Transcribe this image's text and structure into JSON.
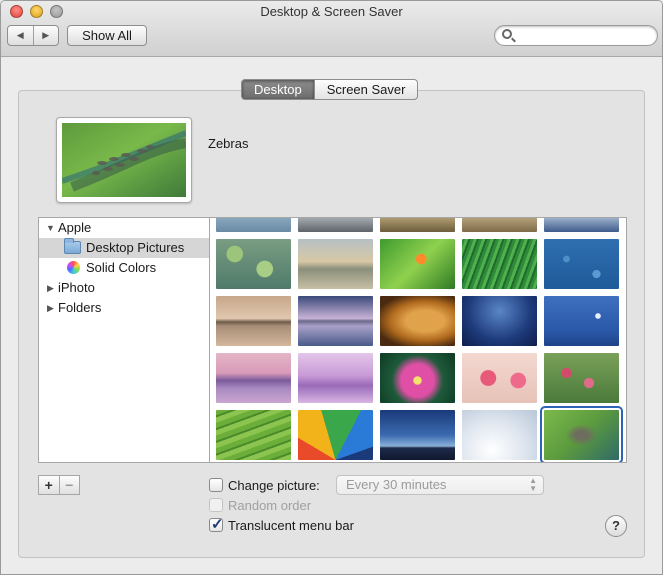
{
  "window": {
    "title": "Desktop & Screen Saver"
  },
  "toolbar": {
    "back_icon": "chevron-left-icon",
    "forward_icon": "chevron-right-icon",
    "show_all_label": "Show All",
    "search": {
      "value": "",
      "placeholder": ""
    }
  },
  "tabs": [
    {
      "label": "Desktop",
      "active": true
    },
    {
      "label": "Screen Saver",
      "active": false
    }
  ],
  "preview": {
    "name": "Zebras"
  },
  "sources": [
    {
      "label": "Apple",
      "icon": "triangle-down-icon",
      "expanded": true
    },
    {
      "label": "Desktop Pictures",
      "icon": "folder-icon",
      "selected": true
    },
    {
      "label": "Solid Colors",
      "icon": "color-wheel-icon"
    },
    {
      "label": "iPhoto",
      "icon": "triangle-right-icon",
      "expanded": false
    },
    {
      "label": "Folders",
      "icon": "triangle-right-icon",
      "expanded": false
    }
  ],
  "thumbnails": [
    {
      "name": "partial-1"
    },
    {
      "name": "partial-2"
    },
    {
      "name": "partial-3"
    },
    {
      "name": "partial-4"
    },
    {
      "name": "partial-5"
    },
    {
      "name": "lily-pads"
    },
    {
      "name": "misty-landscape"
    },
    {
      "name": "frog-on-leaf"
    },
    {
      "name": "grass"
    },
    {
      "name": "blue-drops"
    },
    {
      "name": "island-at-dusk"
    },
    {
      "name": "mountain-reflection"
    },
    {
      "name": "lion"
    },
    {
      "name": "galaxy"
    },
    {
      "name": "crescent-moon"
    },
    {
      "name": "mount-fuji"
    },
    {
      "name": "purple-mist"
    },
    {
      "name": "lotus"
    },
    {
      "name": "pink-poppies"
    },
    {
      "name": "pink-blossoms"
    },
    {
      "name": "rice-terraces"
    },
    {
      "name": "color-wedges"
    },
    {
      "name": "horizon-sky"
    },
    {
      "name": "snow-dunes"
    },
    {
      "name": "zebras",
      "selected": true
    }
  ],
  "options": {
    "change_picture": {
      "label": "Change picture:",
      "checked": false,
      "interval": "Every 30 minutes"
    },
    "random_order": {
      "label": "Random order",
      "checked": false,
      "disabled": true
    },
    "translucent_menu_bar": {
      "label": "Translucent menu bar",
      "checked": true
    }
  },
  "buttons": {
    "add_label": "+",
    "remove_label": "−",
    "help_label": "?"
  },
  "colors": {
    "selection_blue": "#2c63b4",
    "active_tab": "#7a7a7a",
    "source_selected": "#d6d6d6"
  }
}
